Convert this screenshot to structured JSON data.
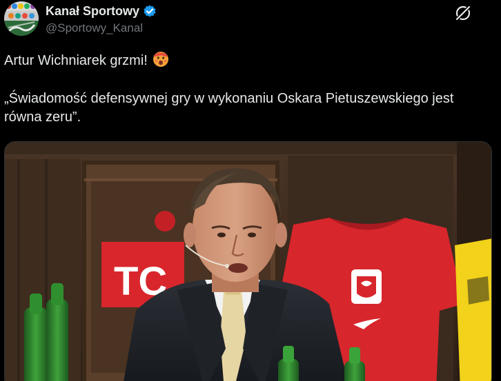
{
  "account": {
    "display_name": "Kanał Sportowy",
    "handle": "@Sportowy_Kanal",
    "verified": true,
    "avatar_icon": "avatar-icon",
    "verified_color": "#1d9bf0"
  },
  "header": {
    "grok_icon": "grok-icon"
  },
  "tweet": {
    "line1": "Artur Wichniarek grzmi!",
    "emoji": "hot-face-emoji",
    "line2": "„Świadomość defensywnej gry w wykonaniu Oskara Pietuszewskiego jest równa zeru”."
  },
  "media": {
    "sign_text": "TC",
    "colors": {
      "background": "#000000",
      "text": "#e7e9ea",
      "secondary_text": "#71767b",
      "jersey_red": "#d7262c",
      "jersey_yellow": "#f2d21a"
    }
  }
}
